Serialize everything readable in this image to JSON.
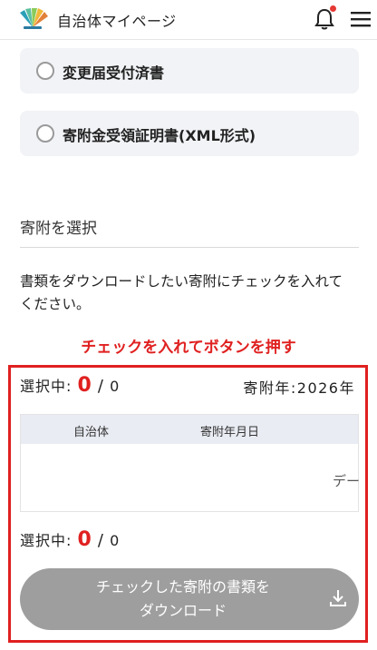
{
  "header": {
    "title": "自治体マイページ",
    "logo_icon": "fan-logo-icon",
    "bell_icon": "bell-icon",
    "menu_icon": "hamburger-menu-icon",
    "notification_color": "#e53935"
  },
  "options": [
    {
      "label": "変更届受付済書",
      "selected": false
    },
    {
      "label": "寄附金受領証明書(XML形式)",
      "selected": false
    }
  ],
  "section": {
    "title": "寄附を選択",
    "instruction": "書類をダウンロードしたい寄附にチェックを入れてください。"
  },
  "annotation": {
    "text": "チェックを入れてボタンを押す",
    "color": "#e02020"
  },
  "selection": {
    "label": "選択中:",
    "count": "0",
    "separator": "/",
    "total": "0"
  },
  "year": {
    "label": "寄附年:",
    "value": "2026年"
  },
  "table": {
    "columns": [
      "自治体",
      "寄附年月日"
    ],
    "empty_text": "デー"
  },
  "download_button": {
    "label_line1": "チェックした寄附の書類を",
    "label_line2": "ダウンロード",
    "icon": "download-icon",
    "enabled": false
  }
}
